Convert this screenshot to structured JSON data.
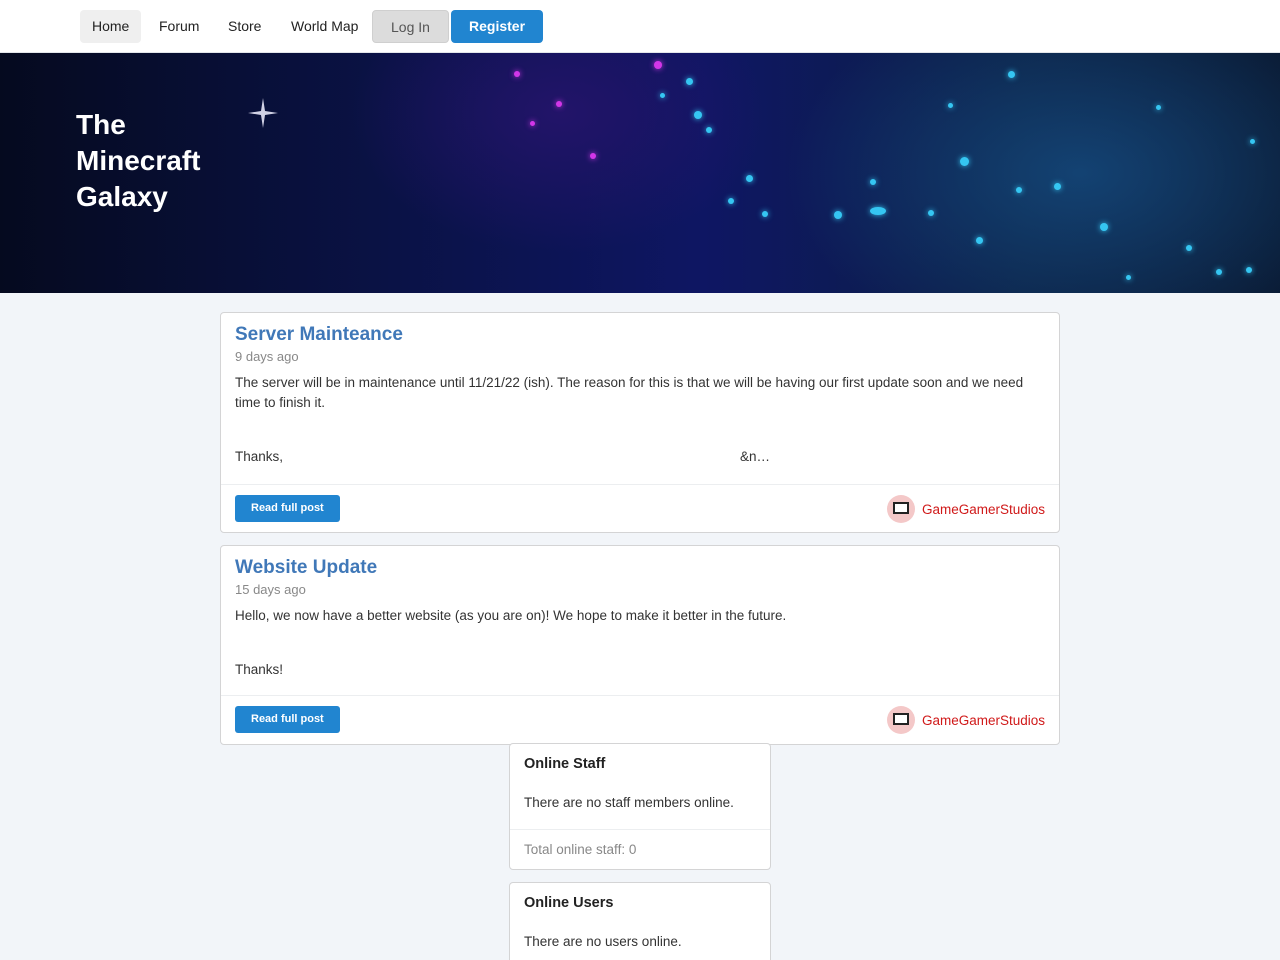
{
  "nav": {
    "items": [
      "Home",
      "Forum",
      "Store",
      "World Map"
    ],
    "login_label": "Log In",
    "register_label": "Register"
  },
  "banner": {
    "title": "The Minecraft Galaxy"
  },
  "posts": [
    {
      "title": "Server Mainteance",
      "time": "9 days ago",
      "text": "The server will be in maintenance until 11/21/22 (ish). The reason for this is that we will be having our first update soon and we need time to finish it.",
      "closing": "Thanks,",
      "truncation": "&n…",
      "read_label": "Read full post",
      "author": "GameGamerStudios"
    },
    {
      "title": "Website Update",
      "time": "15 days ago",
      "text": "Hello, we now have a better website (as you are on)! We hope to make it better in the future.",
      "closing": "Thanks!",
      "read_label": "Read full post",
      "author": "GameGamerStudios"
    }
  ],
  "online_staff": {
    "title": "Online Staff",
    "message": "There are no staff members online.",
    "total": "Total online staff: 0"
  },
  "online_users": {
    "title": "Online Users",
    "message": "There are no users online."
  },
  "colors": {
    "primary": "#2185d0",
    "link": "#4078b8",
    "author": "#d01919"
  }
}
